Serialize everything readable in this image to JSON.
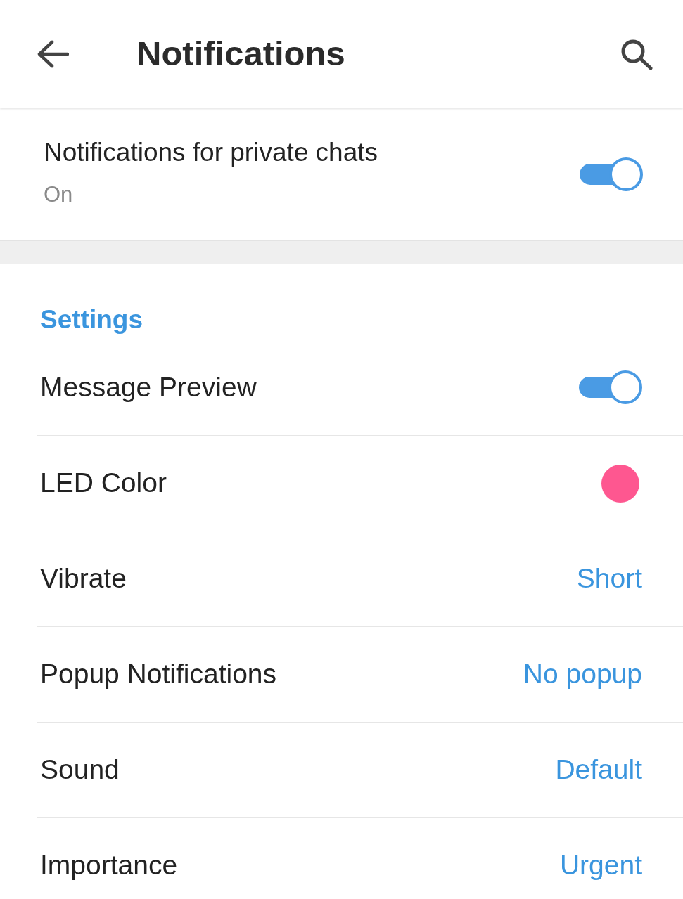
{
  "header": {
    "title": "Notifications"
  },
  "private_chats": {
    "title": "Notifications for private chats",
    "subtitle": "On",
    "on": true
  },
  "settings": {
    "heading": "Settings",
    "rows": [
      {
        "kind": "toggle",
        "label": "Message Preview",
        "on": true
      },
      {
        "kind": "color",
        "label": "LED Color",
        "color": "#fe5790"
      },
      {
        "kind": "value",
        "label": "Vibrate",
        "value": "Short"
      },
      {
        "kind": "value",
        "label": "Popup Notifications",
        "value": "No popup"
      },
      {
        "kind": "value",
        "label": "Sound",
        "value": "Default"
      },
      {
        "kind": "value",
        "label": "Importance",
        "value": "Urgent"
      }
    ]
  }
}
